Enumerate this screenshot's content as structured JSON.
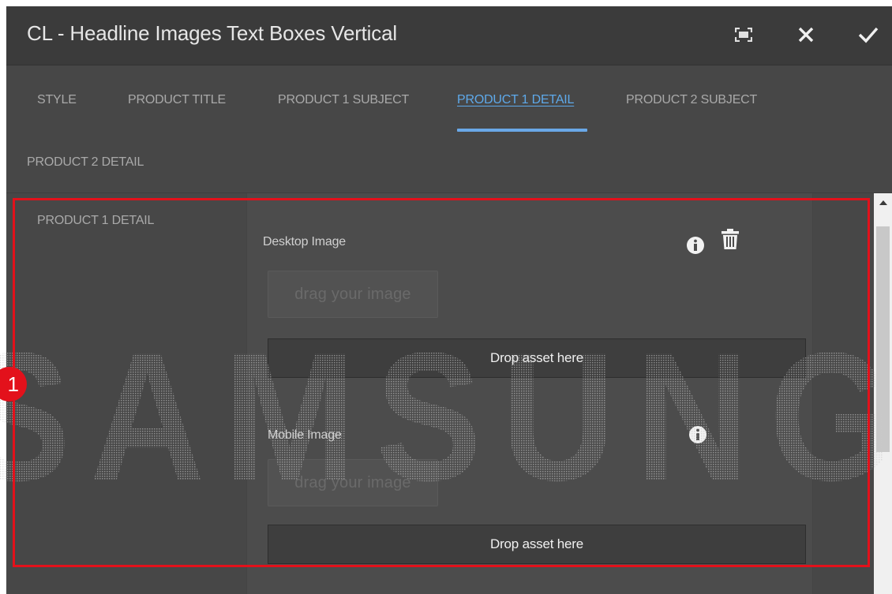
{
  "dialog": {
    "title": "CL - Headline Images Text Boxes Vertical",
    "buttons": {
      "fullscreen_icon": "fullscreen-icon",
      "close_icon": "close-icon",
      "confirm_icon": "check-icon"
    }
  },
  "tabs": [
    {
      "label": "STYLE",
      "active": false
    },
    {
      "label": "PRODUCT TITLE",
      "active": false
    },
    {
      "label": "PRODUCT 1 SUBJECT",
      "active": false
    },
    {
      "label": "PRODUCT 1 DETAIL",
      "active": true
    },
    {
      "label": "PRODUCT 2 SUBJECT",
      "active": false
    },
    {
      "label": "PRODUCT 2 DETAIL",
      "active": false
    }
  ],
  "section": {
    "label": "PRODUCT 1 DETAIL"
  },
  "fields": [
    {
      "label": "Desktop Image",
      "drag_text": "drag your image",
      "drop_text": "Drop asset here",
      "has_delete": true
    },
    {
      "label": "Mobile Image",
      "drag_text": "drag your image",
      "drop_text": "Drop asset here",
      "has_delete": false
    }
  ],
  "watermark": {
    "text": "SAMSUNG"
  },
  "annotation": {
    "number": "1"
  },
  "colors": {
    "accent": "#5ea9ea",
    "highlight": "#e3111b",
    "titlebar": "#3b3b3b",
    "panel": "#474747"
  }
}
